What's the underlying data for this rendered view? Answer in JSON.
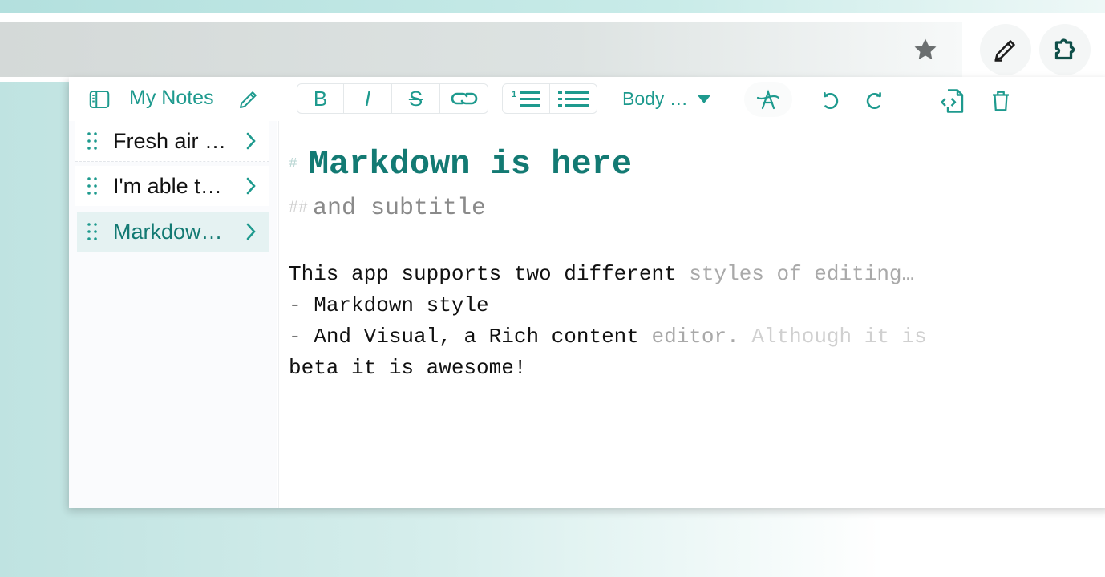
{
  "browser": {
    "toolbar_icons": [
      "star-icon",
      "pencil-icon",
      "extension-puzzle-icon"
    ]
  },
  "app": {
    "title": "My Notes",
    "icons": {
      "sidebar_toggle": "sidebar-toggle-icon",
      "edit_title": "pencil-icon"
    }
  },
  "format_toolbar": {
    "bold": "B",
    "italic": "I",
    "strike": "S",
    "link": "link-icon",
    "ordered_list": "ordered-list-icon",
    "bullet_list": "bullet-list-icon",
    "text_style": "Body …",
    "clear_format": "clear-format-icon",
    "undo": "undo-icon",
    "redo": "redo-icon",
    "source_mode": "code-file-icon",
    "delete": "trash-icon"
  },
  "notes": [
    {
      "label": "Fresh air …",
      "selected": false
    },
    {
      "label": "I'm able t…",
      "selected": false
    },
    {
      "label": "Markdow…",
      "selected": true
    }
  ],
  "editor": {
    "h1_marker": "#",
    "h1_text": "Markdown is here",
    "h2_marker": "##",
    "h2_text": "and subtitle",
    "line1_a": "This app supports two different ",
    "line1_b": "styles of editing…",
    "line2_dash": "-",
    "line2_text": " Markdown style",
    "line3_dash": "-",
    "line3_a": " And Visual, a Rich content ",
    "line3_b": "editor. ",
    "line3_c": "Although it is",
    "line4": "beta it is awesome!"
  },
  "colors": {
    "accent": "#1e9a8e",
    "heading": "#137a73",
    "selected_bg": "#e5f2f2"
  }
}
